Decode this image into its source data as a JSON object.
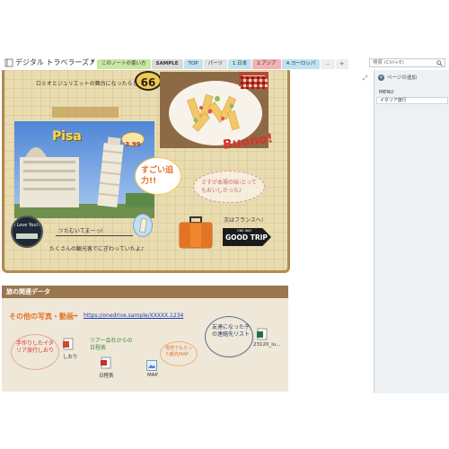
{
  "header": {
    "notebook_title": "デジタル トラベラーズノート",
    "tabs": [
      {
        "label": "このノートの使い方",
        "color": "#c9e7a3"
      },
      {
        "label": "SAMPLE",
        "color": "#d9d9d9"
      },
      {
        "label": "TOP",
        "color": "#bfe3ef"
      },
      {
        "label": "パーツ",
        "color": "#e3e3e3"
      },
      {
        "label": "1.日本",
        "color": "#bfe3ef"
      },
      {
        "label": "2.アジア",
        "color": "#f4b3b3"
      },
      {
        "label": "4.ヨーロッパ",
        "color": "#bfe3ef"
      },
      {
        "label": "...",
        "color": "#eeeeee"
      }
    ],
    "add_tab": "+",
    "search_placeholder": "検索 (Ctrl+E)"
  },
  "page": {
    "top_note": "ロミオとジュリエットの舞台になったらしい!!",
    "number_badge": "66",
    "pisa_label": "Pisa",
    "price_tag": "3.99",
    "sticker_text": "I Love You!!",
    "lean_caption": "ツたむいてまーっ!",
    "impressed": "すごい迫力!!",
    "buono": "Buono!",
    "delicious": "さすが本場の味!とってもおいしかった♪",
    "next_label": "次はフランスへ!",
    "sign_top": "ONE WAY",
    "sign_text": "GOOD TRIP",
    "tourist_note": "たくさんの観光客でにぎわっていたよ♪"
  },
  "right_pane": {
    "add_page": "ページの追加",
    "menu_label": "MENU",
    "page_item": "イタリア旅行"
  },
  "bottom": {
    "section_title": "旅の関連データ",
    "photos_label": "その他の写真・動画",
    "link": "https://onedrive.sample/XXXXX.1234",
    "handmade_note": "手作りしたイタリア旅行しおり",
    "shiori_label": "しおり",
    "itinerary_note": "ツアー会社からの日程表",
    "itinerary_label": "日程表",
    "map_note": "現地でもらった観光MAP",
    "map_label": "MAP",
    "friend_note": "友達になった子の連絡先リスト",
    "excel_label": "23120_iu..."
  },
  "colors": {
    "board": "#e9dcb0",
    "board_border": "#b08b53",
    "data_bar": "#9b7750",
    "accent_orange": "#e2742a",
    "accent_red": "#d9312e"
  }
}
